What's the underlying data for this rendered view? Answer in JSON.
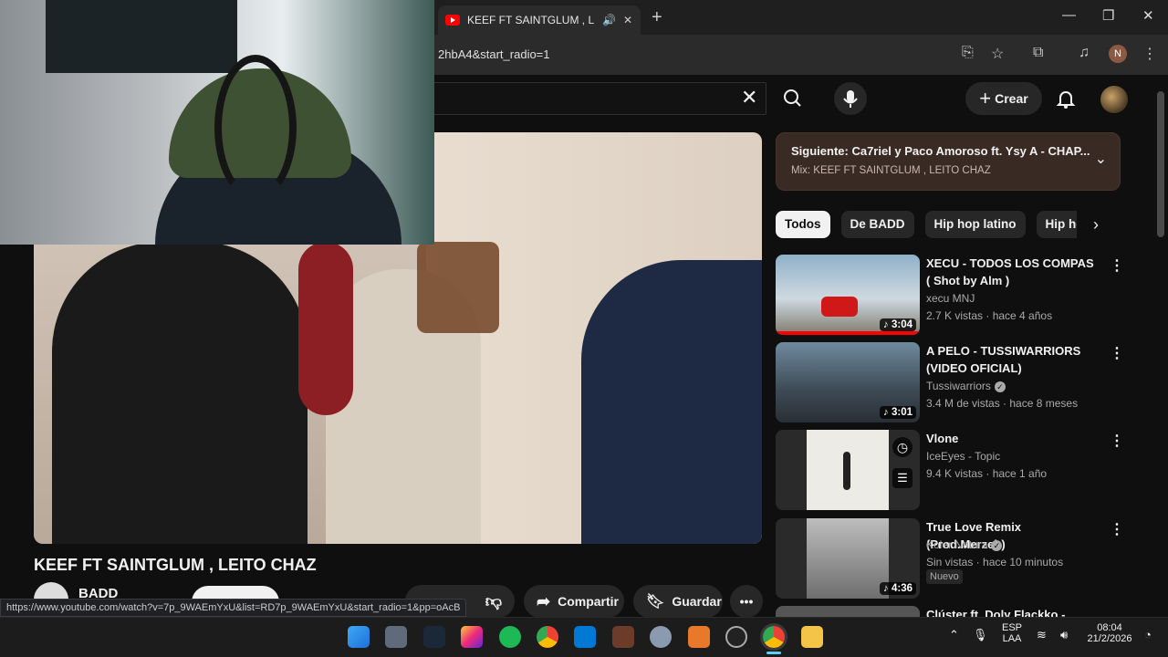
{
  "browser": {
    "tab_title": "KEEF FT SAINTGLUM , LEITO",
    "url_fragment": "2hbA4&start_radio=1",
    "profile_initial": "N",
    "status_url": "https://www.youtube.com/watch?v=7p_9WAEmYxU&list=RD7p_9WAEmYxU&start_radio=1&pp=oAcB"
  },
  "header": {
    "create_label": "Crear"
  },
  "video": {
    "title": "KEEF FT SAINTGLUM , LEITO CHAZ",
    "channel": "BADD",
    "share_label": "Compartir",
    "save_label": "Guardar"
  },
  "up_next": {
    "title": "Siguiente: Ca7riel y Paco Amoroso ft. Ysy A - CHAP...",
    "mix": "Mix: KEEF FT SAINTGLUM , LEITO CHAZ"
  },
  "chips": [
    "Todos",
    "De BADD",
    "Hip hop latino",
    "Hip hop"
  ],
  "recommendations": [
    {
      "title": "XECU - TODOS LOS COMPAS ( Shot by Alm )",
      "channel": "xecu MNJ",
      "verified": false,
      "meta": "2.7 K vistas · hace 4 años",
      "duration": "3:04"
    },
    {
      "title": "A PELO - TUSSIWARRIORS (VIDEO OFICIAL)",
      "channel": "Tussiwarriors",
      "verified": true,
      "meta": "3.4 M de vistas · hace 8 meses",
      "duration": "3:01"
    },
    {
      "title": "Vlone",
      "channel": "IceEyes - Topic",
      "verified": false,
      "meta": "9.4 K vistas · hace 1 año",
      "duration": ""
    },
    {
      "title": "True Love Remix (Prod.Merzeh)",
      "channel": "Koler Natura",
      "verified": true,
      "meta": "Sin vistas · hace 10 minutos",
      "duration": "4:36",
      "badge": "Nuevo"
    },
    {
      "title": "Clúster ft. Doly Flackko - OREO",
      "channel": "",
      "verified": false,
      "meta": "",
      "duration": ""
    }
  ],
  "taskbar": {
    "lang_top": "ESP",
    "lang_bottom": "LAA",
    "time": "08:04",
    "date": "21/2/2026"
  },
  "colors": {
    "accent_red": "#ff0000",
    "bg": "#0f0f0f",
    "chip_bg": "#272727"
  }
}
